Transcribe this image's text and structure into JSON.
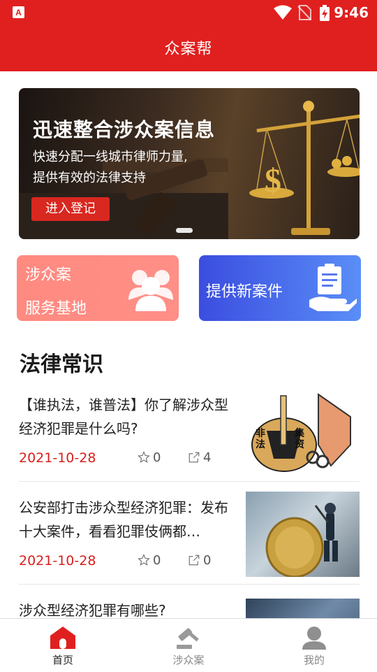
{
  "status_bar": {
    "time": "9:46"
  },
  "app_bar": {
    "title": "众案帮"
  },
  "banner": {
    "headline": "迅速整合涉众案信息",
    "sub_line1": "快速分配一线城市律师力量,",
    "sub_line2": "提供有效的法律支持",
    "cta_label": "进入登记"
  },
  "cards": {
    "left": {
      "line1": "涉众案",
      "line2": "服务基地"
    },
    "right": {
      "label": "提供新案件"
    }
  },
  "section": {
    "title": "法律常识"
  },
  "news": [
    {
      "title": "【谁执法，谁普法】你了解涉众型经济犯罪是什么吗?",
      "date": "2021-10-28",
      "favorites": "0",
      "shares": "4"
    },
    {
      "title": "公安部打击涉众型经济犯罪：发布十大案件，看看犯罪伎俩都…",
      "date": "2021-10-28",
      "favorites": "0",
      "shares": "0"
    },
    {
      "title": "涉众型经济犯罪有哪些?"
    }
  ],
  "thumb1": {
    "left_text": "非法",
    "right_text": "集资"
  },
  "tabs": [
    {
      "label": "首页",
      "icon": "home-icon",
      "active": true
    },
    {
      "label": "涉众案",
      "icon": "gavel-icon",
      "active": false
    },
    {
      "label": "我的",
      "icon": "profile-icon",
      "active": false
    }
  ],
  "colors": {
    "brand_red": "#e0201f",
    "date_red": "#d8201c",
    "card_pink": "#ff8a80",
    "card_blue": "#4a66ea"
  }
}
